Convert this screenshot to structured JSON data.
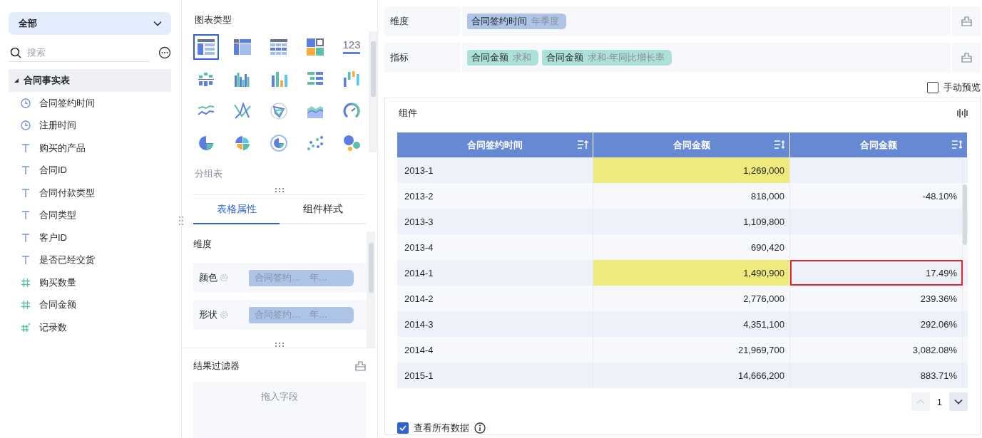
{
  "sidebar": {
    "scope": {
      "value": "全部"
    },
    "search": {
      "placeholder": "搜索"
    },
    "tree": {
      "label": "合同事实表",
      "expanded": true,
      "children": [
        {
          "label": "合同签约时间",
          "kind": "time"
        },
        {
          "label": "注册时间",
          "kind": "time"
        },
        {
          "label": "购买的产品",
          "kind": "text"
        },
        {
          "label": "合同ID",
          "kind": "text"
        },
        {
          "label": "合同付款类型",
          "kind": "text"
        },
        {
          "label": "合同类型",
          "kind": "text"
        },
        {
          "label": "客户ID",
          "kind": "text"
        },
        {
          "label": "是否已经交货",
          "kind": "text"
        },
        {
          "label": "购买数量",
          "kind": "number"
        },
        {
          "label": "合同金额",
          "kind": "number"
        },
        {
          "label": "记录数",
          "kind": "count"
        }
      ]
    }
  },
  "chart_panel": {
    "title": "图表类型",
    "chart_types": [
      {
        "kind": "grouped-table",
        "selected": true
      },
      {
        "kind": "cross-table",
        "selected": false
      },
      {
        "kind": "detail-table",
        "selected": false
      },
      {
        "kind": "treemap",
        "selected": false
      },
      {
        "kind": "kpi",
        "label": "123",
        "selected": false
      },
      {
        "kind": "stacked-column",
        "selected": false
      },
      {
        "kind": "grouped-column",
        "selected": false
      },
      {
        "kind": "column",
        "selected": false
      },
      {
        "kind": "bar",
        "selected": false
      },
      {
        "kind": "range-column",
        "selected": false
      },
      {
        "kind": "line",
        "selected": false
      },
      {
        "kind": "parallel",
        "selected": false
      },
      {
        "kind": "radar",
        "selected": false
      },
      {
        "kind": "area",
        "selected": false
      },
      {
        "kind": "gauge",
        "selected": false
      },
      {
        "kind": "pie",
        "selected": false
      },
      {
        "kind": "rose",
        "selected": false
      },
      {
        "kind": "ring",
        "selected": false
      },
      {
        "kind": "scatter",
        "selected": false
      },
      {
        "kind": "bubble",
        "selected": false
      }
    ],
    "current_type": "分组表",
    "tabs": [
      {
        "label": "表格属性",
        "selected": true
      },
      {
        "label": "组件样式",
        "selected": false
      }
    ],
    "properties": {
      "title": "维度",
      "rows": [
        {
          "label": "颜色",
          "field": "合同签约…",
          "detail": "年…"
        },
        {
          "label": "形状",
          "field": "合同签约…",
          "detail": "年…"
        }
      ]
    },
    "result_filter": {
      "title": "结果过滤器",
      "placeholder": "拖入字段"
    }
  },
  "shelves": [
    {
      "label": "维度",
      "tags": [
        {
          "name": "合同签约时间",
          "detail": "年季度",
          "kind": "dimension"
        }
      ]
    },
    {
      "label": "指标",
      "tags": [
        {
          "name": "合同金额",
          "detail": "求和",
          "kind": "measure"
        },
        {
          "name": "合同金额",
          "detail": "求和-年同比增长率",
          "kind": "measure"
        }
      ]
    }
  ],
  "manual_preview": {
    "label": "手动预览",
    "checked": false
  },
  "component": {
    "title": "组件",
    "table": {
      "columns": [
        {
          "label": "合同签约时间",
          "kind": "sorted-ascending"
        },
        {
          "label": "合同金额",
          "kind": "sortable"
        },
        {
          "label": "合同金额",
          "kind": "sortable"
        }
      ],
      "rows": [
        {
          "time": "2013-1",
          "amount": "1,269,000",
          "amount_highlighted": true,
          "rate_selected": false
        },
        {
          "time": "2013-2",
          "amount": "818,000",
          "amount_highlighted": false,
          "rate": "-48.10%",
          "rate_selected": false
        },
        {
          "time": "2013-3",
          "amount": "1,109,800",
          "amount_highlighted": false,
          "rate_selected": false
        },
        {
          "time": "2013-4",
          "amount": "690,420",
          "amount_highlighted": false,
          "rate_selected": false
        },
        {
          "time": "2014-1",
          "amount": "1,490,900",
          "amount_highlighted": true,
          "rate": "17.49%",
          "rate_selected": true
        },
        {
          "time": "2014-2",
          "amount": "2,776,000",
          "amount_highlighted": false,
          "rate": "239.36%",
          "rate_selected": false
        },
        {
          "time": "2014-3",
          "amount": "4,351,100",
          "amount_highlighted": false,
          "rate": "292.06%",
          "rate_selected": false
        },
        {
          "time": "2014-4",
          "amount": "21,969,700",
          "amount_highlighted": false,
          "rate": "3,082.08%",
          "rate_selected": false
        },
        {
          "time": "2015-1",
          "amount": "14,666,200",
          "amount_highlighted": false,
          "rate": "883.71%",
          "rate_selected": false
        }
      ]
    },
    "pagination": {
      "page": "1",
      "prev_disabled": true,
      "next_disabled": false
    },
    "view_all": {
      "label": "查看所有数据",
      "checked": true
    }
  }
}
